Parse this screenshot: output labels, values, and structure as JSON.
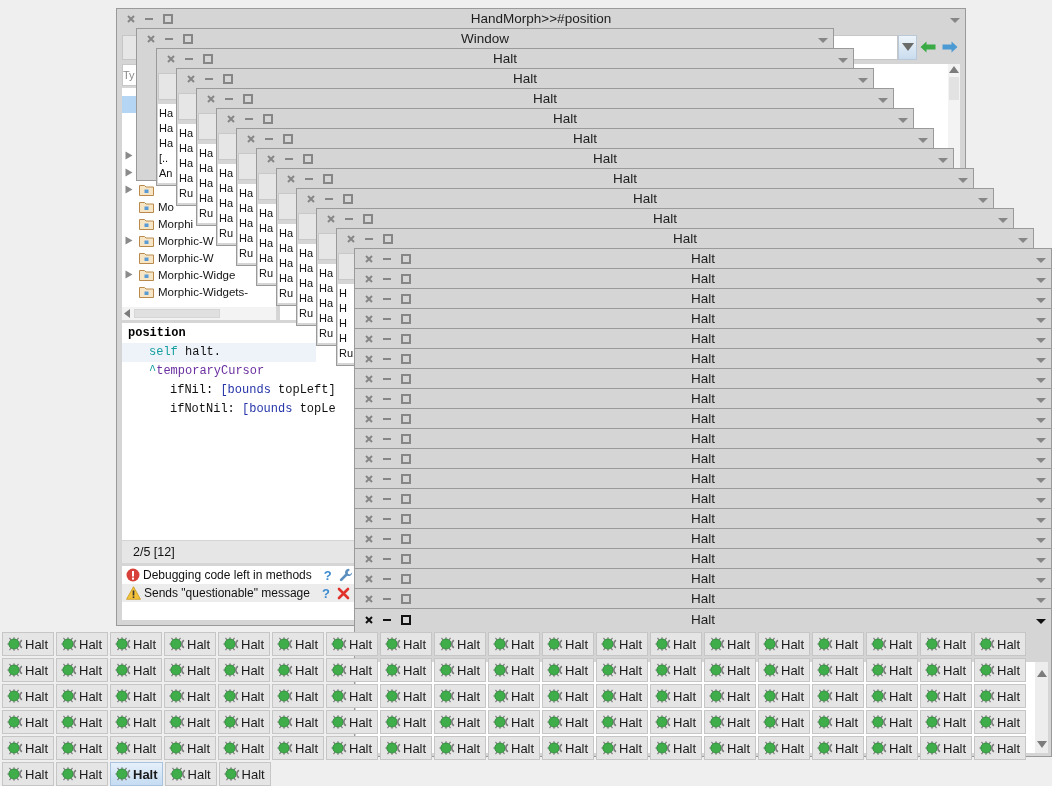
{
  "browser": {
    "title": "HandMorph>>#position",
    "active": false,
    "package_filter": {
      "placeholder": "Ty"
    },
    "packages": [
      {
        "selected": true,
        "expandable": false
      },
      {
        "selected": false,
        "expandable": false
      },
      {
        "selected": false,
        "expandable": false
      },
      {
        "selected": false,
        "expandable": true
      },
      {
        "selected": false,
        "expandable": true
      },
      {
        "selected": false,
        "expandable": true,
        "kind": "package"
      },
      {
        "selected": false,
        "expandable": false,
        "kind": "package",
        "label": "Mo"
      },
      {
        "selected": false,
        "expandable": false,
        "kind": "package",
        "label": "Morphi"
      },
      {
        "selected": false,
        "expandable": true,
        "kind": "package",
        "label": "Morphic-W"
      },
      {
        "selected": false,
        "expandable": false,
        "kind": "package",
        "label": "Morphic-W"
      },
      {
        "selected": false,
        "expandable": true,
        "kind": "package",
        "label": "Morphic-Widge"
      },
      {
        "selected": false,
        "expandable": false,
        "kind": "package",
        "label": "Morphic-Widgets-"
      }
    ],
    "code": {
      "lines": [
        {
          "highlighted": false,
          "tokens": [
            {
              "kind": "method",
              "text": "position"
            }
          ],
          "children": [
            {
              "highlighted": true,
              "tokens": [
                {
                  "kind": "pseudo",
                  "text": "self"
                },
                {
                  "kind": "plain",
                  "text": " halt."
                }
              ]
            },
            {
              "highlighted": false,
              "tokens": [
                {
                  "kind": "return",
                  "text": "^"
                },
                {
                  "kind": "ivar",
                  "text": "temporaryCursor"
                }
              ],
              "children": [
                {
                  "highlighted": false,
                  "tokens": [
                    {
                      "kind": "plain",
                      "text": "ifNil: "
                    },
                    {
                      "kind": "block",
                      "text": "[bounds"
                    },
                    {
                      "kind": "plain",
                      "text": " topLeft]"
                    }
                  ]
                },
                {
                  "highlighted": false,
                  "tokens": [
                    {
                      "kind": "plain",
                      "text": "ifNotNil: "
                    },
                    {
                      "kind": "block",
                      "text": "[bounds"
                    },
                    {
                      "kind": "plain",
                      "text": " topLe"
                    }
                  ]
                }
              ]
            }
          ]
        }
      ]
    },
    "status": "2/5 [12]",
    "critiques": [
      {
        "kind": "error",
        "text": "Debugging code left in methods",
        "help": "?",
        "action": {
          "kind": "autofix"
        }
      },
      {
        "kind": "warning",
        "text": "Sends \"questionable\" message",
        "help": "?",
        "action": {
          "kind": "ban"
        }
      }
    ]
  },
  "windows": [
    {
      "title": "Window",
      "active": false
    },
    {
      "title": "Halt",
      "active": false,
      "stack": [
        "Ha",
        "Ha",
        "Ha",
        "[..",
        "An"
      ]
    },
    {
      "title": "Halt",
      "active": false,
      "stack": [
        "Ha",
        "Ha",
        "Ha",
        "Ha",
        "Ru"
      ]
    },
    {
      "title": "Halt",
      "active": false,
      "stack": [
        "Ha",
        "Ha",
        "Ha",
        "Ha",
        "Ru"
      ]
    },
    {
      "title": "Halt",
      "active": false,
      "stack": [
        "Ha",
        "Ha",
        "Ha",
        "Ha",
        "Ru"
      ]
    },
    {
      "title": "Halt",
      "active": false,
      "stack": [
        "Ha",
        "Ha",
        "Ha",
        "Ha",
        "Ru"
      ]
    },
    {
      "title": "Halt",
      "active": false,
      "stack": [
        "Ha",
        "Ha",
        "Ha",
        "Ha",
        "Ru"
      ]
    },
    {
      "title": "Halt",
      "active": false,
      "stack": [
        "Ha",
        "Ha",
        "Ha",
        "Ha",
        "Ru"
      ]
    },
    {
      "title": "Halt",
      "active": false,
      "stack": [
        "Ha",
        "Ha",
        "Ha",
        "Ha",
        "Ru"
      ]
    },
    {
      "title": "Halt",
      "active": false,
      "stack": [
        "Ha",
        "Ha",
        "Ha",
        "Ha",
        "Ru"
      ]
    },
    {
      "title": "Halt",
      "active": false,
      "stack": [
        "H",
        "H",
        "H",
        "H",
        "Ru"
      ]
    },
    {
      "title": "Halt",
      "active": false
    },
    {
      "title": "Halt",
      "active": false
    },
    {
      "title": "Halt",
      "active": false
    },
    {
      "title": "Halt",
      "active": false
    },
    {
      "title": "Halt",
      "active": false
    },
    {
      "title": "Halt",
      "active": false
    },
    {
      "title": "Halt",
      "active": false
    },
    {
      "title": "Halt",
      "active": false
    },
    {
      "title": "Halt",
      "active": false
    },
    {
      "title": "Halt",
      "active": false
    },
    {
      "title": "Halt",
      "active": false
    },
    {
      "title": "Halt",
      "active": false
    },
    {
      "title": "Halt",
      "active": false
    },
    {
      "title": "Halt",
      "active": false
    },
    {
      "title": "Halt",
      "active": false
    },
    {
      "title": "Halt",
      "active": false
    },
    {
      "title": "Halt",
      "active": false
    },
    {
      "title": "Halt",
      "active": false
    },
    {
      "title": "Halt",
      "active": true
    }
  ],
  "taskbar": [
    {
      "label": "Halt",
      "selected": false
    },
    {
      "label": "Halt",
      "selected": false
    },
    {
      "label": "Halt",
      "selected": false
    },
    {
      "label": "Halt",
      "selected": false
    },
    {
      "label": "Halt",
      "selected": false
    },
    {
      "label": "Halt",
      "selected": false
    },
    {
      "label": "Halt",
      "selected": false
    },
    {
      "label": "Halt",
      "selected": false
    },
    {
      "label": "Halt",
      "selected": false
    },
    {
      "label": "Halt",
      "selected": false
    },
    {
      "label": "Halt",
      "selected": false
    },
    {
      "label": "Halt",
      "selected": false
    },
    {
      "label": "Halt",
      "selected": false
    },
    {
      "label": "Halt",
      "selected": false
    },
    {
      "label": "Halt",
      "selected": false
    },
    {
      "label": "Halt",
      "selected": false
    },
    {
      "label": "Halt",
      "selected": false
    },
    {
      "label": "Halt",
      "selected": false
    },
    {
      "label": "Halt",
      "selected": false
    },
    {
      "label": "Halt",
      "selected": false
    },
    {
      "label": "Halt",
      "selected": false
    },
    {
      "label": "Halt",
      "selected": false
    },
    {
      "label": "Halt",
      "selected": false
    },
    {
      "label": "Halt",
      "selected": false
    },
    {
      "label": "Halt",
      "selected": false
    },
    {
      "label": "Halt",
      "selected": false
    },
    {
      "label": "Halt",
      "selected": false
    },
    {
      "label": "Halt",
      "selected": false
    },
    {
      "label": "Halt",
      "selected": false
    },
    {
      "label": "Halt",
      "selected": false
    },
    {
      "label": "Halt",
      "selected": false
    },
    {
      "label": "Halt",
      "selected": false
    },
    {
      "label": "Halt",
      "selected": false
    },
    {
      "label": "Halt",
      "selected": false
    },
    {
      "label": "Halt",
      "selected": false
    },
    {
      "label": "Halt",
      "selected": false
    },
    {
      "label": "Halt",
      "selected": false
    },
    {
      "label": "Halt",
      "selected": false
    },
    {
      "label": "Halt",
      "selected": false
    },
    {
      "label": "Halt",
      "selected": false
    },
    {
      "label": "Halt",
      "selected": false
    },
    {
      "label": "Halt",
      "selected": false
    },
    {
      "label": "Halt",
      "selected": false
    },
    {
      "label": "Halt",
      "selected": false
    },
    {
      "label": "Halt",
      "selected": false
    },
    {
      "label": "Halt",
      "selected": false
    },
    {
      "label": "Halt",
      "selected": false
    },
    {
      "label": "Halt",
      "selected": false
    },
    {
      "label": "Halt",
      "selected": false
    },
    {
      "label": "Halt",
      "selected": false
    },
    {
      "label": "Halt",
      "selected": false
    },
    {
      "label": "Halt",
      "selected": false
    },
    {
      "label": "Halt",
      "selected": false
    },
    {
      "label": "Halt",
      "selected": false
    },
    {
      "label": "Halt",
      "selected": false
    },
    {
      "label": "Halt",
      "selected": false
    },
    {
      "label": "Halt",
      "selected": false
    },
    {
      "label": "Halt",
      "selected": false
    },
    {
      "label": "Halt",
      "selected": false
    },
    {
      "label": "Halt",
      "selected": false
    },
    {
      "label": "Halt",
      "selected": false
    },
    {
      "label": "Halt",
      "selected": false
    },
    {
      "label": "Halt",
      "selected": false
    },
    {
      "label": "Halt",
      "selected": false
    },
    {
      "label": "Halt",
      "selected": false
    },
    {
      "label": "Halt",
      "selected": false
    },
    {
      "label": "Halt",
      "selected": false
    },
    {
      "label": "Halt",
      "selected": false
    },
    {
      "label": "Halt",
      "selected": false
    },
    {
      "label": "Halt",
      "selected": false
    },
    {
      "label": "Halt",
      "selected": false
    },
    {
      "label": "Halt",
      "selected": false
    },
    {
      "label": "Halt",
      "selected": false
    },
    {
      "label": "Halt",
      "selected": false
    },
    {
      "label": "Halt",
      "selected": false
    },
    {
      "label": "Halt",
      "selected": false
    },
    {
      "label": "Halt",
      "selected": false
    },
    {
      "label": "Halt",
      "selected": false
    },
    {
      "label": "Halt",
      "selected": false
    },
    {
      "label": "Halt",
      "selected": false
    },
    {
      "label": "Halt",
      "selected": false
    },
    {
      "label": "Halt",
      "selected": false
    },
    {
      "label": "Halt",
      "selected": false
    },
    {
      "label": "Halt",
      "selected": false
    },
    {
      "label": "Halt",
      "selected": false
    },
    {
      "label": "Halt",
      "selected": false
    },
    {
      "label": "Halt",
      "selected": false
    },
    {
      "label": "Halt",
      "selected": false
    },
    {
      "label": "Halt",
      "selected": false
    },
    {
      "label": "Halt",
      "selected": false
    },
    {
      "label": "Halt",
      "selected": false
    },
    {
      "label": "Halt",
      "selected": false
    },
    {
      "label": "Halt",
      "selected": false
    },
    {
      "label": "Halt",
      "selected": false
    },
    {
      "label": "Halt",
      "selected": false
    },
    {
      "label": "Halt",
      "selected": false
    },
    {
      "label": "Halt",
      "selected": false
    },
    {
      "label": "Halt",
      "selected": true
    },
    {
      "label": "Halt",
      "selected": false
    },
    {
      "label": "Halt",
      "selected": false
    }
  ]
}
